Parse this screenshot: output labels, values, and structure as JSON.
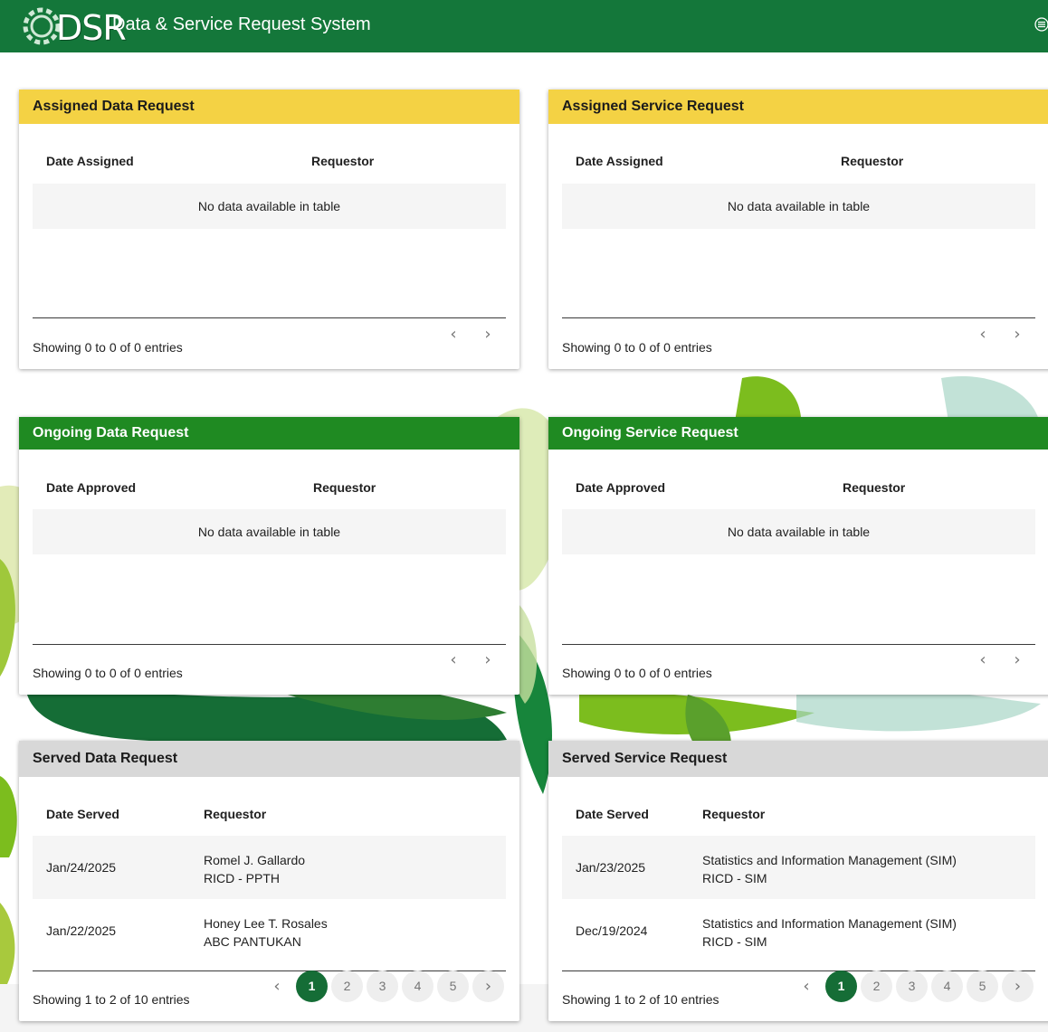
{
  "app": {
    "logo_text": "DSR",
    "title": "Data & Service Request System"
  },
  "colors": {
    "topbar": "#14773a",
    "header_yellow": "#f4d244",
    "header_green": "#1f8a22",
    "header_gray": "#d8d8d8",
    "pager_active": "#156d36"
  },
  "cards": {
    "assigned_data": {
      "title": "Assigned Data Request",
      "columns": [
        "Date Assigned",
        "Requestor"
      ],
      "empty": "No data available in table",
      "info": "Showing 0 to 0 of 0 entries"
    },
    "assigned_service": {
      "title": "Assigned Service Request",
      "columns": [
        "Date Assigned",
        "Requestor"
      ],
      "empty": "No data available in table",
      "info": "Showing 0 to 0 of 0 entries"
    },
    "ongoing_data": {
      "title": "Ongoing Data Request",
      "columns": [
        "Date Approved",
        "Requestor"
      ],
      "empty": "No data available in table",
      "info": "Showing 0 to 0 of 0 entries"
    },
    "ongoing_service": {
      "title": "Ongoing Service Request",
      "columns": [
        "Date Approved",
        "Requestor"
      ],
      "empty": "No data available in table",
      "info": "Showing 0 to 0 of 0 entries"
    },
    "served_data": {
      "title": "Served Data Request",
      "columns": [
        "Date Served",
        "Requestor"
      ],
      "rows": [
        {
          "date": "Jan/24/2025",
          "name": "Romel J. Gallardo",
          "office": "RICD - PPTH"
        },
        {
          "date": "Jan/22/2025",
          "name": "Honey Lee T. Rosales",
          "office": "ABC PANTUKAN"
        }
      ],
      "info": "Showing 1 to 2 of 10 entries",
      "pages": [
        "1",
        "2",
        "3",
        "4",
        "5"
      ],
      "current_page": "1"
    },
    "served_service": {
      "title": "Served Service Request",
      "columns": [
        "Date Served",
        "Requestor"
      ],
      "rows": [
        {
          "date": "Jan/23/2025",
          "name": "Statistics and Information Management (SIM)",
          "office": "RICD - SIM"
        },
        {
          "date": "Dec/19/2024",
          "name": "Statistics and Information Management (SIM)",
          "office": "RICD - SIM"
        }
      ],
      "info": "Showing 1 to 2 of 10 entries",
      "pages": [
        "1",
        "2",
        "3",
        "4",
        "5"
      ],
      "current_page": "1"
    }
  },
  "icons": {
    "prev": "chevron-left-icon",
    "next": "chevron-right-icon",
    "menu": "menu-icon"
  }
}
